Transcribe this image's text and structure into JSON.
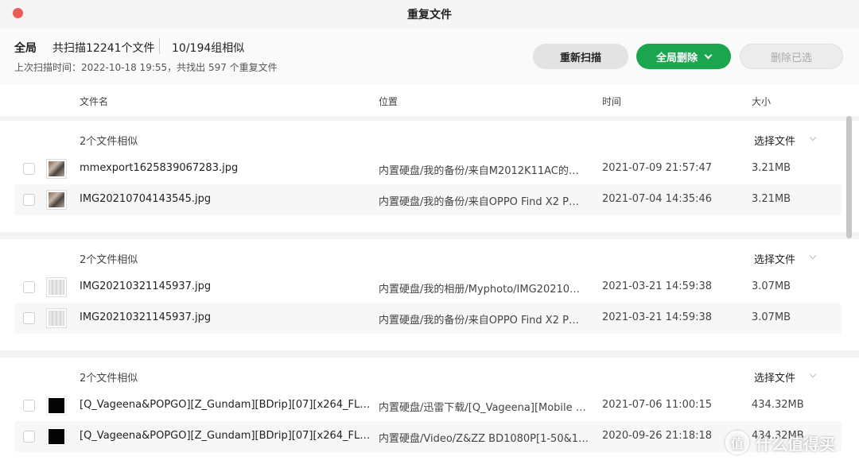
{
  "window": {
    "title": "重复文件"
  },
  "header": {
    "scope": "全局",
    "scanned": "共扫描12241个文件",
    "groups": "10/194组相似",
    "last_scan": "上次扫描时间：2022-10-18 19:55，共找出 597 个重复文件"
  },
  "buttons": {
    "rescan": "重新扫描",
    "global_delete": "全局删除",
    "delete_selected": "删除已选"
  },
  "columns": {
    "name": "文件名",
    "location": "位置",
    "time": "时间",
    "size": "大小"
  },
  "groups": [
    {
      "count_label": "2个文件相似",
      "select_label": "选择文件",
      "files": [
        {
          "name": "mmexport1625839067283.jpg",
          "location": "内置硬盘/我的备份/来自M2012K11AC的…",
          "time": "2021-07-09 21:57:47",
          "size": "3.21MB",
          "thumb": "photo"
        },
        {
          "name": "IMG20210704143545.jpg",
          "location": "内置硬盘/我的备份/来自OPPO Find X2 P…",
          "time": "2021-07-04 14:35:46",
          "size": "3.21MB",
          "thumb": "photo"
        }
      ]
    },
    {
      "count_label": "2个文件相似",
      "select_label": "选择文件",
      "files": [
        {
          "name": "IMG20210321145937.jpg",
          "location": "内置硬盘/我的相册/Myphoto/IMG20210…",
          "time": "2021-03-21 14:59:38",
          "size": "3.07MB",
          "thumb": "light"
        },
        {
          "name": "IMG20210321145937.jpg",
          "location": "内置硬盘/我的备份/来自OPPO Find X2 P…",
          "time": "2021-03-21 14:59:38",
          "size": "3.07MB",
          "thumb": "light"
        }
      ]
    },
    {
      "count_label": "2个文件相似",
      "select_label": "选择文件",
      "files": [
        {
          "name": "[Q_Vageena&POPGO][Z_Gundam][BDrip][07][x264_FL…",
          "location": "内置硬盘/迅雷下载/[Q_Vageena][Mobile …",
          "time": "2021-07-06 11:00:15",
          "size": "434.32MB",
          "thumb": "black"
        },
        {
          "name": "[Q_Vageena&POPGO][Z_Gundam][BDrip][07][x264_FL…",
          "location": "内置硬盘/Video/Z&ZZ BD1080P[1-50&1…",
          "time": "2020-09-26 21:18:18",
          "size": "434.32MB",
          "thumb": "black"
        }
      ]
    }
  ],
  "watermark": {
    "logo_char": "值",
    "text": "什么值得买"
  }
}
